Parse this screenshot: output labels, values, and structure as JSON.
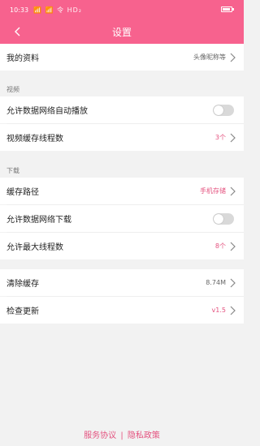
{
  "status_bar": {
    "time": "10:33",
    "signal": "📶 📶 令 HD₂"
  },
  "nav": {
    "title": "设置"
  },
  "profile": {
    "label": "我的资料",
    "value": "头像昵称等"
  },
  "sections": {
    "video": "视频",
    "download": "下载"
  },
  "video": {
    "autoplay_label": "允许数据网络自动播放",
    "threads_label": "视频缓存线程数",
    "threads_value": "3个"
  },
  "download": {
    "path_label": "缓存路径",
    "path_value": "手机存储",
    "mobile_label": "允许数据网络下载",
    "max_threads_label": "允许最大线程数",
    "max_threads_value": "8个"
  },
  "misc": {
    "clear_cache_label": "清除缓存",
    "cache_size": "8.74M",
    "check_update_label": "检查更新",
    "version": "v1.5"
  },
  "footer": {
    "terms": "服务协议",
    "separator": "|",
    "privacy": "隐私政策"
  },
  "colors": {
    "accent": "#f7628e",
    "value_pink": "#e4527f",
    "toggle_off": "#d9d9d9"
  }
}
